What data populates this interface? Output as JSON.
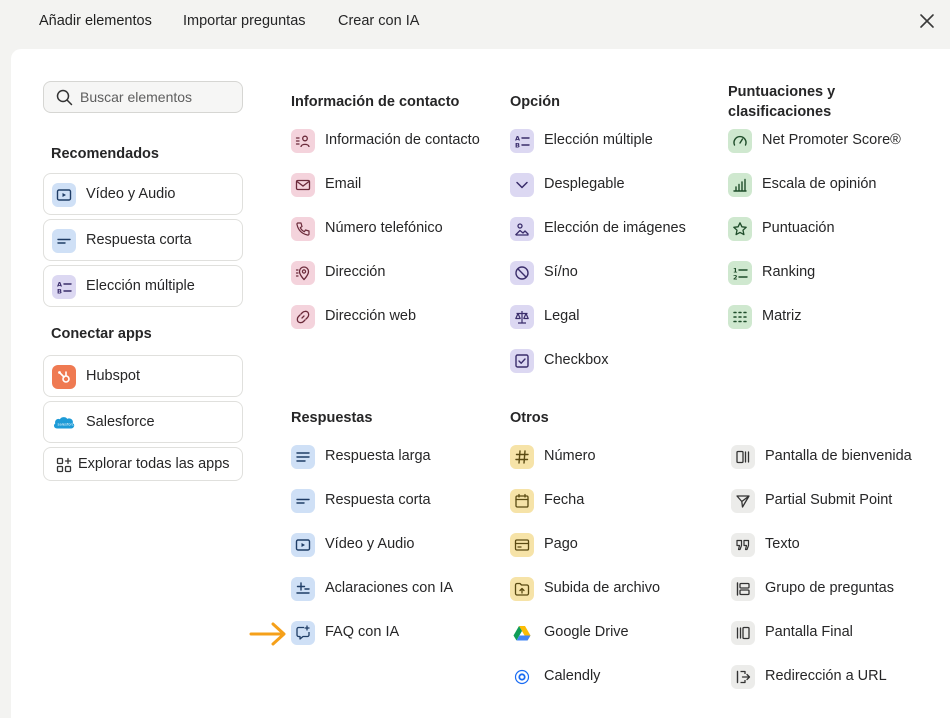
{
  "tabs": [
    "Añadir elementos",
    "Importar preguntas",
    "Crear con IA"
  ],
  "search": {
    "placeholder": "Buscar elementos"
  },
  "sidebar": {
    "recommended_title": "Recomendados",
    "recommended": [
      "Vídeo y Audio",
      "Respuesta corta",
      "Elección múltiple"
    ],
    "apps_title": "Conectar apps",
    "apps": [
      "Hubspot",
      "Salesforce"
    ],
    "explore": "Explorar todas las apps"
  },
  "contact": {
    "title": "Información de contacto",
    "items": [
      "Información de contacto",
      "Email",
      "Número telefónico",
      "Dirección",
      "Dirección web"
    ]
  },
  "choice": {
    "title": "Opción",
    "items": [
      "Elección múltiple",
      "Desplegable",
      "Elección de imágenes",
      "Sí/no",
      "Legal",
      "Checkbox"
    ]
  },
  "ratings": {
    "title": "Puntuaciones y clasificaciones",
    "items": [
      "Net Promoter Score®",
      "Escala de opinión",
      "Puntuación",
      "Ranking",
      "Matriz"
    ]
  },
  "answers": {
    "title": "Respuestas",
    "items": [
      "Respuesta larga",
      "Respuesta corta",
      "Vídeo y Audio",
      "Aclaraciones con IA",
      "FAQ con IA"
    ]
  },
  "others": {
    "title": "Otros",
    "items": [
      "Número",
      "Fecha",
      "Pago",
      "Subida de archivo",
      "Google Drive",
      "Calendly"
    ]
  },
  "others2": {
    "items": [
      "Pantalla de bienvenida",
      "Partial Submit Point",
      "Texto",
      "Grupo de preguntas",
      "Pantalla Final",
      "Redirección a URL"
    ]
  },
  "colors": {
    "contact": "#f4d3dc",
    "choice": "#dcd8f2",
    "ratings": "#cfe8cf",
    "answers": "#cfe0f6",
    "others": "#f6e3a8",
    "arrow": "#f5a01a"
  }
}
